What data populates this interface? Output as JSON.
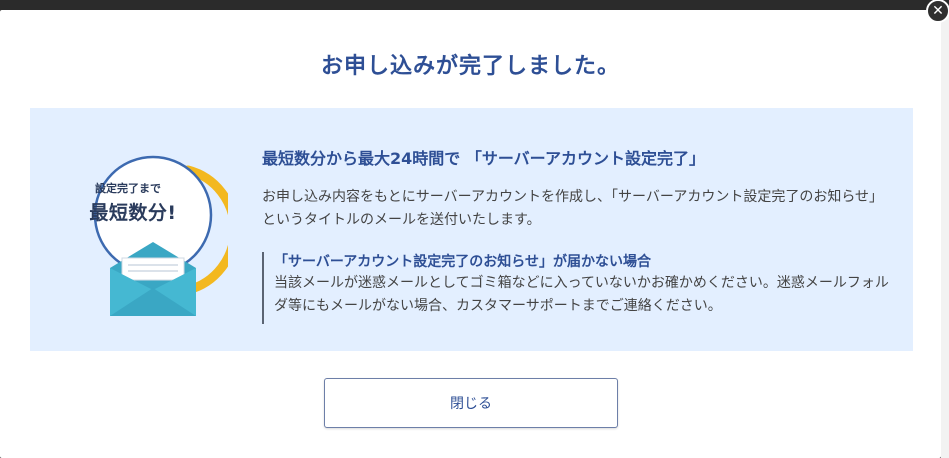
{
  "modal": {
    "title": "お申し込みが完了しました。",
    "close_icon": "close-icon"
  },
  "info": {
    "badge_line1": "設定完了まで",
    "badge_line2": "最短数分!",
    "heading": "最短数分から最大24時間で 「サーバーアカウント設定完了」",
    "description": "お申し込み内容をもとにサーバーアカウントを作成し、「サーバーアカウント設定完了のお知らせ」というタイトルのメールを送付いたします。",
    "notice_title": "「サーバーアカウント設定完了のお知らせ」が届かない場合",
    "notice_body": "当該メールが迷惑メールとしてゴミ箱などに入っていないかお確かめください。迷惑メールフォルダ等にもメールがない場合、カスタマーサポートまでご連絡ください。"
  },
  "buttons": {
    "close_label": "閉じる"
  },
  "colors": {
    "accent": "#2e4f95",
    "box_bg": "#e3efff",
    "envelope": "#3aa7c4",
    "arrow": "#f3b81f"
  }
}
